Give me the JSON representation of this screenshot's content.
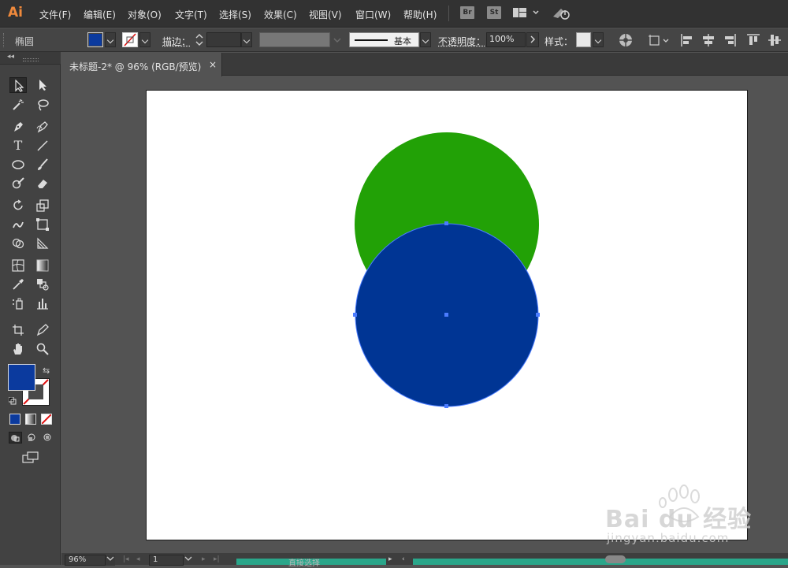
{
  "app": {
    "logo": "Ai"
  },
  "menu": [
    {
      "label": "文件(F)"
    },
    {
      "label": "编辑(E)"
    },
    {
      "label": "对象(O)"
    },
    {
      "label": "文字(T)"
    },
    {
      "label": "选择(S)"
    },
    {
      "label": "效果(C)"
    },
    {
      "label": "视图(V)"
    },
    {
      "label": "窗口(W)"
    },
    {
      "label": "帮助(H)"
    }
  ],
  "menu_icons": {
    "bridge": "Br",
    "stock": "St"
  },
  "control": {
    "object_type": "椭圆",
    "fill_color": "#0b3a9e",
    "stroke_label": "描边：",
    "stroke_profile": "基本",
    "opacity_label": "不透明度：",
    "opacity_value": "100%",
    "style_label": "样式："
  },
  "document": {
    "tab_title": "未标题-2* @ 96% (RGB/预览)",
    "close_glyph": "×"
  },
  "tools": {
    "fill_color": "#0b3a9e",
    "stroke_color": "none"
  },
  "canvas": {
    "green_circle_color": "#22a106",
    "blue_circle_color": "#003594",
    "selection_color": "#4b7cff"
  },
  "status": {
    "zoom": "96%",
    "artboard_number": "1",
    "tool_status": "直接选择"
  },
  "watermark": {
    "brand": "Bai du 经验",
    "url": "jingyan.baidu.com"
  }
}
